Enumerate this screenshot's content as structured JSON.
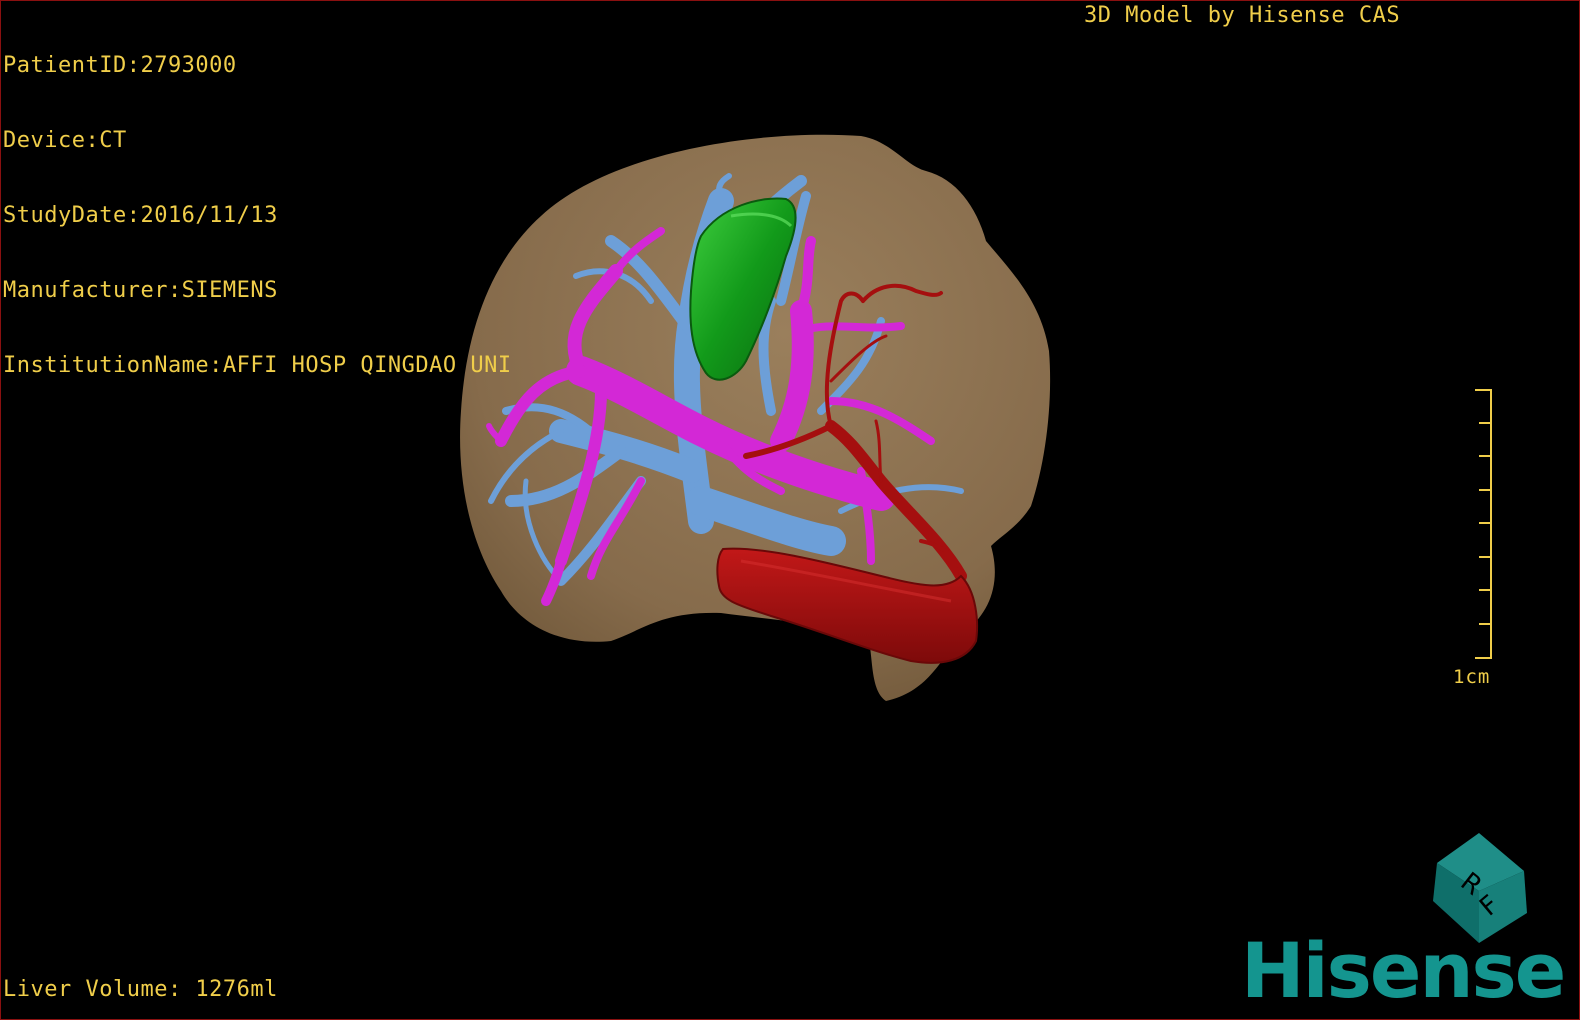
{
  "header": {
    "patient_id": "PatientID:2793000",
    "device": "Device:CT",
    "study_date": "StudyDate:2016/11/13",
    "manufacturer": "Manufacturer:SIEMENS",
    "institution": "InstitutionName:AFFI HOSP QINGDAO UNI"
  },
  "brand_caption": "3D Model by Hisense CAS",
  "footer": {
    "liver_volume": "Liver Volume: 1276ml"
  },
  "scale_bar": {
    "label": "1cm"
  },
  "orientation_cube": {
    "face_letters": [
      "R",
      "F"
    ]
  },
  "logo": {
    "text": "Hisense"
  },
  "colors": {
    "overlay_text": "#f0ce4a",
    "liver": "#8c7150",
    "hepatic_vein": "#6d9fd8",
    "portal_vein": "#d328d6",
    "gallbladder": "#14a020",
    "artery": "#a50f0f",
    "logo": "#14958f"
  },
  "icons": {
    "orientation_cube": "orientation-cube-icon",
    "scale_bar": "scale-ruler-icon"
  }
}
